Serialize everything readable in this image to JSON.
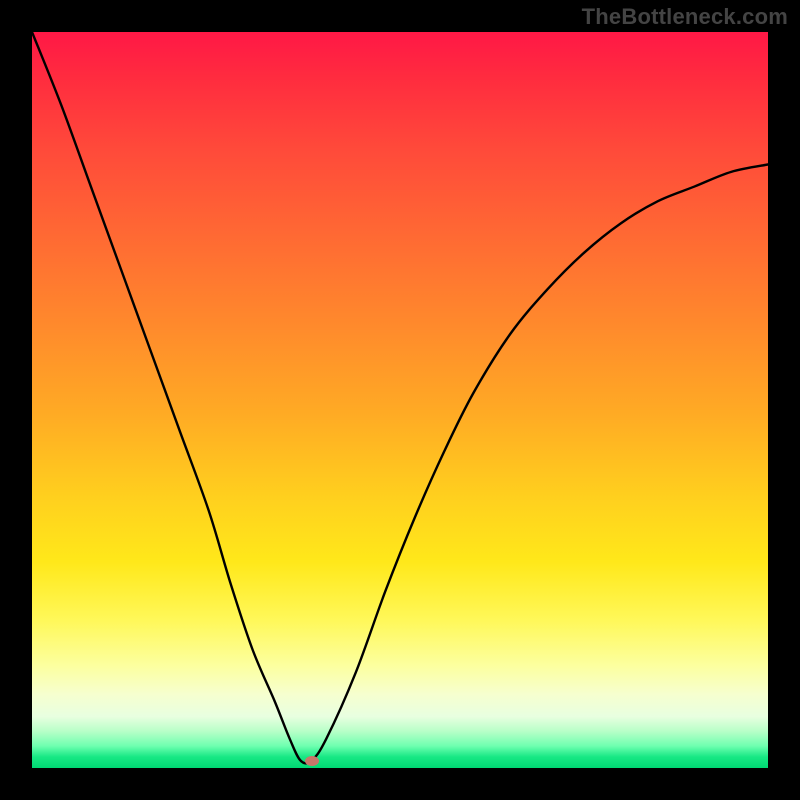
{
  "watermark": "TheBottleneck.com",
  "chart_data": {
    "type": "line",
    "title": "",
    "xlabel": "",
    "ylabel": "",
    "xlim": [
      0,
      100
    ],
    "ylim": [
      0,
      100
    ],
    "series": [
      {
        "name": "bottleneck-curve",
        "x": [
          0,
          4,
          8,
          12,
          16,
          20,
          24,
          27,
          30,
          33,
          35,
          36.5,
          38,
          40,
          44,
          48,
          52,
          56,
          60,
          65,
          70,
          75,
          80,
          85,
          90,
          95,
          100
        ],
        "values": [
          100,
          90,
          79,
          68,
          57,
          46,
          35,
          25,
          16,
          9,
          4,
          1,
          1,
          4,
          13,
          24,
          34,
          43,
          51,
          59,
          65,
          70,
          74,
          77,
          79,
          81,
          82
        ]
      }
    ],
    "marker": {
      "name": "optimal-point",
      "x": 38,
      "y": 1,
      "color": "#c7776a"
    },
    "background_gradient": {
      "direction": "vertical",
      "stops": [
        {
          "pos": 0.0,
          "color": "#ff1846"
        },
        {
          "pos": 0.4,
          "color": "#ff8a2c"
        },
        {
          "pos": 0.72,
          "color": "#ffe81a"
        },
        {
          "pos": 0.9,
          "color": "#f6ffcf"
        },
        {
          "pos": 1.0,
          "color": "#00d873"
        }
      ]
    }
  }
}
